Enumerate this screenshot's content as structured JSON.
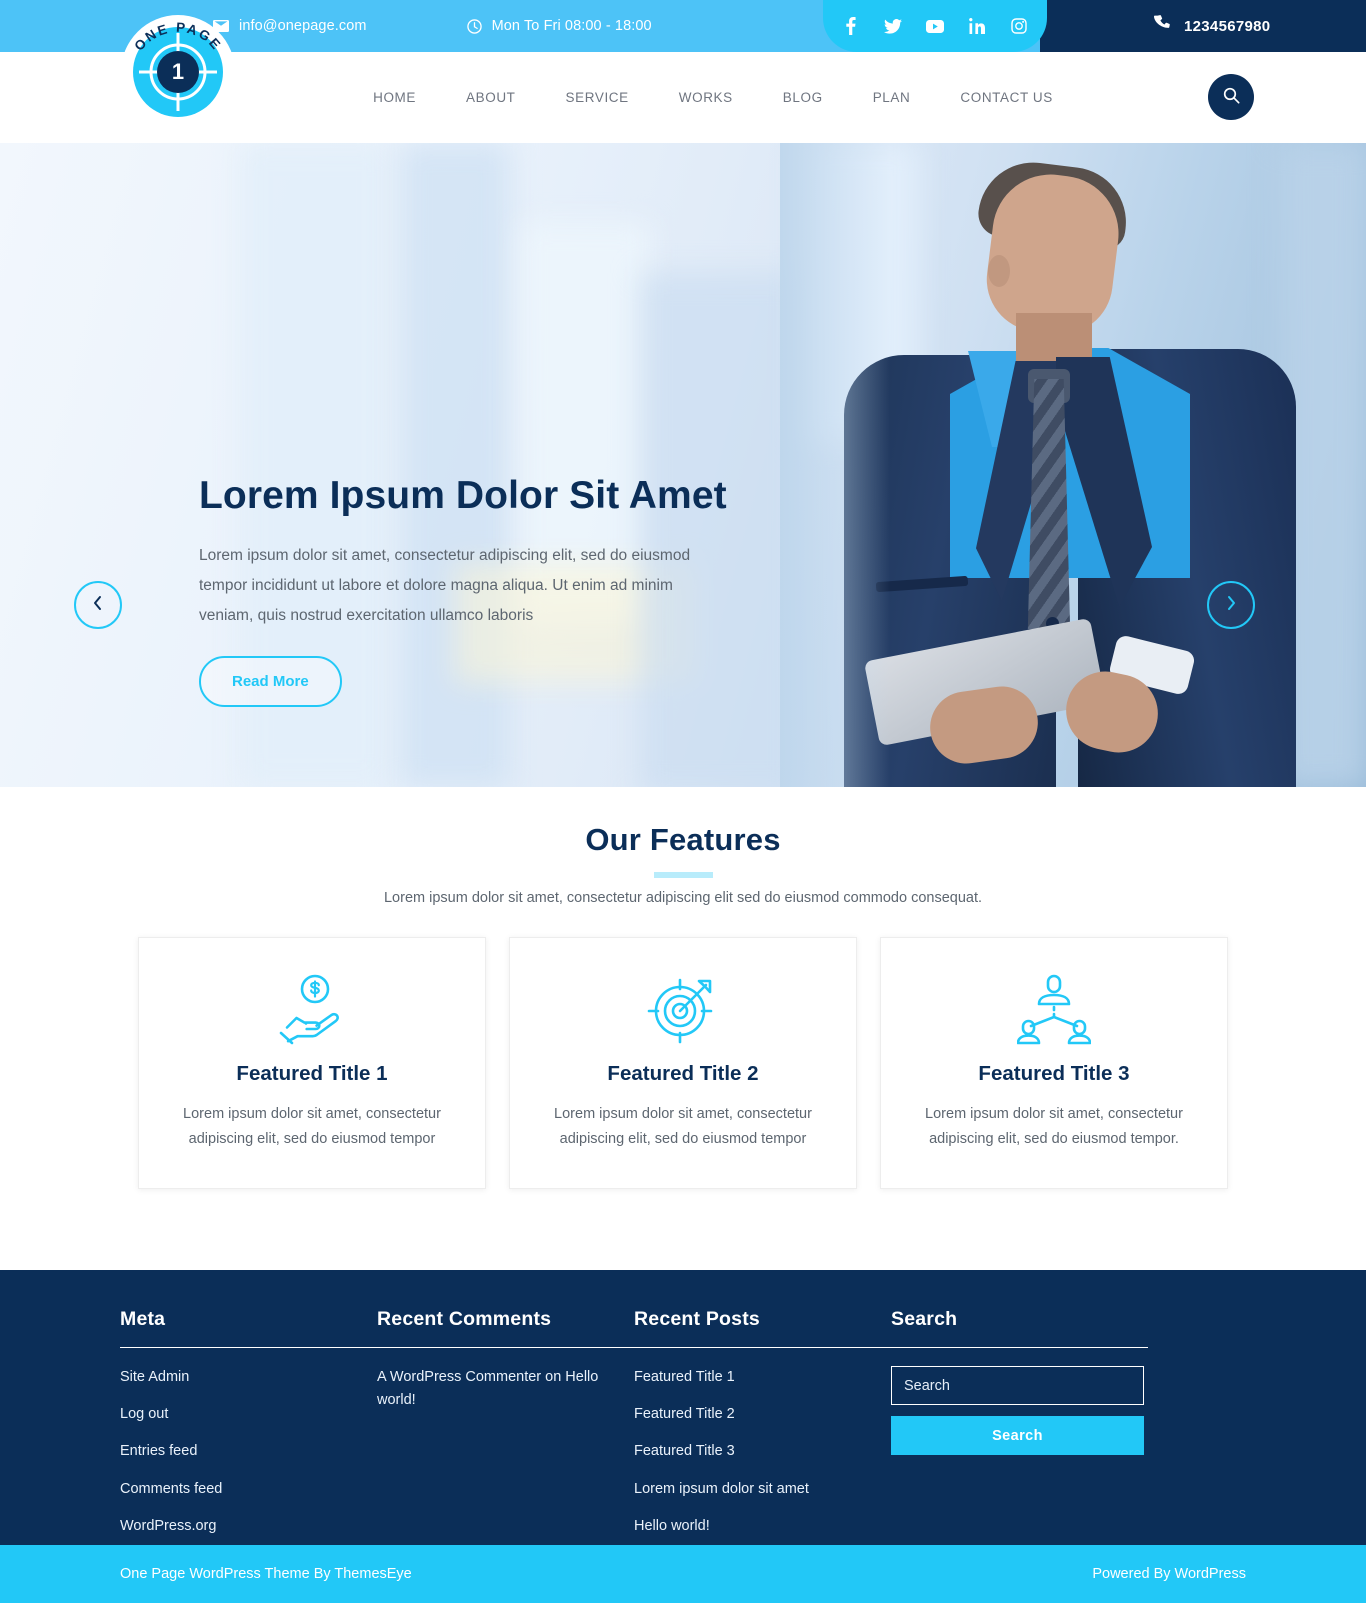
{
  "topbar": {
    "email": "info@onepage.com",
    "hours": "Mon To Fri 08:00 - 18:00",
    "phone": "1234567980",
    "email_icon": "envelope-icon",
    "clock_icon": "clock-icon",
    "phone_icon": "phone-icon",
    "social": [
      {
        "name": "facebook-icon",
        "label": "f"
      },
      {
        "name": "twitter-icon",
        "label": "t"
      },
      {
        "name": "youtube-icon",
        "label": "yt"
      },
      {
        "name": "linkedin-icon",
        "label": "in"
      },
      {
        "name": "instagram-icon",
        "label": "ig"
      }
    ]
  },
  "logo": {
    "arc_text": "ONE PAGE",
    "center_number": "1"
  },
  "nav": {
    "items": [
      {
        "label": "HOME"
      },
      {
        "label": "ABOUT"
      },
      {
        "label": "SERVICE"
      },
      {
        "label": "WORKS"
      },
      {
        "label": "BLOG"
      },
      {
        "label": "PLAN"
      },
      {
        "label": "CONTACT US"
      }
    ],
    "search_icon": "search-icon"
  },
  "hero": {
    "title": "Lorem Ipsum Dolor Sit Amet",
    "description": "Lorem ipsum dolor sit amet, consectetur adipiscing elit, sed do eiusmod tempor incididunt ut labore et dolore magna aliqua. Ut enim ad minim veniam, quis nostrud exercitation ullamco laboris",
    "cta": "Read More",
    "prev_icon": "chevron-left-icon",
    "next_icon": "chevron-right-icon"
  },
  "features": {
    "title": "Our Features",
    "subtitle": "Lorem ipsum dolor sit amet, consectetur adipiscing elit sed do eiusmod commodo consequat.",
    "cards": [
      {
        "icon": "hand-holding-dollar-icon",
        "title": "Featured Title 1",
        "desc": "Lorem ipsum dolor sit amet, consectetur adipiscing elit, sed do eiusmod tempor"
      },
      {
        "icon": "target-arrow-icon",
        "title": "Featured Title 2",
        "desc": "Lorem ipsum dolor sit amet, consectetur adipiscing elit, sed do eiusmod tempor"
      },
      {
        "icon": "team-hierarchy-icon",
        "title": "Featured Title 3",
        "desc": "Lorem ipsum dolor sit amet, consectetur adipiscing elit, sed do eiusmod tempor."
      }
    ]
  },
  "footer": {
    "meta": {
      "heading": "Meta",
      "items": [
        "Site Admin",
        "Log out",
        "Entries feed",
        "Comments feed",
        "WordPress.org"
      ]
    },
    "recent_comments": {
      "heading": "Recent Comments",
      "items": [
        "A WordPress Commenter on Hello world!"
      ]
    },
    "recent_posts": {
      "heading": "Recent Posts",
      "items": [
        "Featured Title 1",
        "Featured Title 2",
        "Featured Title 3",
        "Lorem ipsum dolor sit amet",
        "Hello world!"
      ]
    },
    "search": {
      "heading": "Search",
      "placeholder": "Search",
      "value": "",
      "button": "Search"
    }
  },
  "bottombar": {
    "left": "One Page WordPress Theme By ThemesEye",
    "right": "Powered By WordPress"
  },
  "colors": {
    "cyan": "#22c8f7",
    "light_cyan": "#4dc3f7",
    "navy": "#0b2e58",
    "underline": "#b8ecfb",
    "body_text": "#5d6670"
  }
}
